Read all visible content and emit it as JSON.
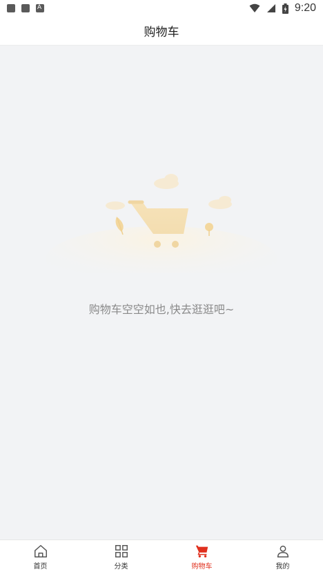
{
  "status_bar": {
    "time": "9:20"
  },
  "header": {
    "title": "购物车"
  },
  "empty_state": {
    "message": "购物车空空如也,快去逛逛吧~"
  },
  "tabbar": {
    "active_color": "#e0301e",
    "items": [
      {
        "label": "首页",
        "icon": "home-icon"
      },
      {
        "label": "分类",
        "icon": "grid-icon"
      },
      {
        "label": "购物车",
        "icon": "cart-icon",
        "active": true
      },
      {
        "label": "我的",
        "icon": "user-icon"
      }
    ]
  }
}
